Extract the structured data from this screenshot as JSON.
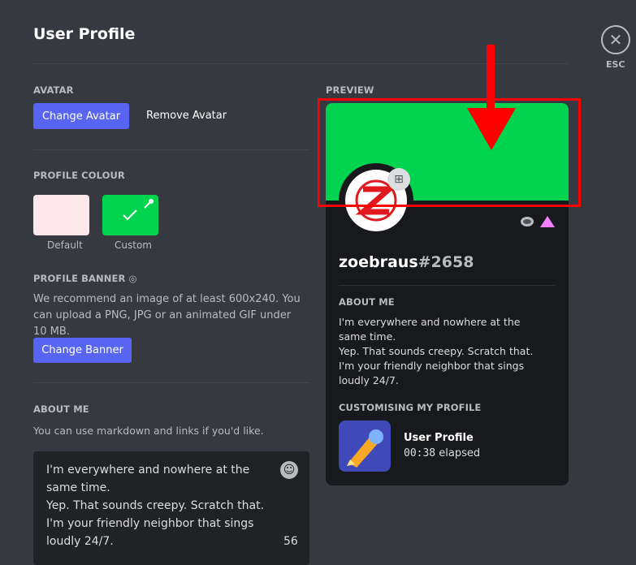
{
  "header": {
    "title": "User Profile",
    "close_label": "ESC"
  },
  "avatar": {
    "label": "AVATAR",
    "change": "Change Avatar",
    "remove": "Remove Avatar"
  },
  "profile_colour": {
    "label": "PROFILE COLOUR",
    "default_label": "Default",
    "custom_label": "Custom",
    "default_color": "#fce8ea",
    "custom_color": "#00d44f",
    "selected": "Custom"
  },
  "banner": {
    "label": "PROFILE BANNER",
    "description": "We recommend an image of at least 600x240. You can upload a PNG, JPG or an animated GIF under 10 MB.",
    "button": "Change Banner"
  },
  "about": {
    "label": "ABOUT ME",
    "hint": "You can use markdown and links if you'd like.",
    "value": "I'm everywhere and nowhere at the same time.\nYep. That sounds creepy. Scratch that.\nI'm your friendly neighbor that sings loudly 24/7.",
    "remaining": "56"
  },
  "preview": {
    "label": "PREVIEW",
    "banner_color": "#00d44f",
    "username": "zoebraus",
    "discriminator": "#2658",
    "about_label": "ABOUT ME",
    "about_text": "I'm everywhere and nowhere at the same time.\nYep. That sounds creepy. Scratch that.\nI'm your friendly neighbor that sings loudly 24/7.",
    "activity_label": "CUSTOMISING MY PROFILE",
    "activity_title": "User Profile",
    "activity_time": "00:38",
    "activity_suffix": "elapsed"
  },
  "annotation": {
    "color": "#ff0000"
  }
}
